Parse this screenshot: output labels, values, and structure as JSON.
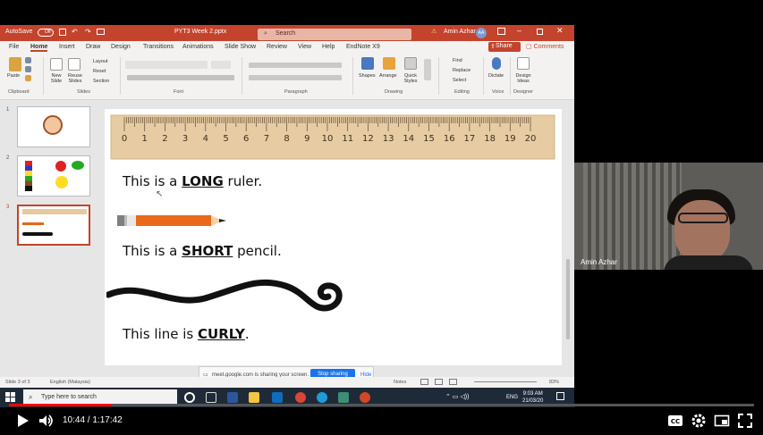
{
  "ppt": {
    "autosave": "AutoSave",
    "autosave_state": "Off",
    "file_title": "PYT3 Week 2.pptx",
    "search_placeholder": "Search",
    "user": "Amin Azhar",
    "user_initials": "AA",
    "menu_tabs": [
      "File",
      "Home",
      "Insert",
      "Draw",
      "Design",
      "Transitions",
      "Animations",
      "Slide Show",
      "Review",
      "View",
      "Help",
      "EndNote X9"
    ],
    "active_tab": "Home",
    "share_label": "Share",
    "comments_label": "Comments",
    "ribbon": {
      "paste": "Paste",
      "new_slide": "New Slide",
      "reuse_slides": "Reuse Slides",
      "layout": "Layout",
      "reset": "Reset",
      "section": "Section",
      "shapes": "Shapes",
      "arrange": "Arrange",
      "quick_styles": "Quick Styles",
      "find": "Find",
      "replace": "Replace",
      "select": "Select",
      "dictate": "Dictate",
      "design_ideas": "Design Ideas",
      "groups": [
        "Clipboard",
        "Slides",
        "Font",
        "Paragraph",
        "Drawing",
        "Editing",
        "Voice",
        "Designer"
      ]
    },
    "thumb_numbers": [
      "1",
      "2",
      "3"
    ],
    "slide": {
      "ruler_numbers": [
        "0",
        "1",
        "2",
        "3",
        "4",
        "5",
        "6",
        "7",
        "8",
        "9",
        "10",
        "11",
        "12",
        "13",
        "14",
        "15",
        "16",
        "17",
        "18",
        "19",
        "20"
      ],
      "line1_pre": "This is a ",
      "line1_word": "LONG",
      "line1_post": " ruler.",
      "line2_pre": "This is a ",
      "line2_word": "SHORT",
      "line2_post": " pencil.",
      "line3_pre": "This line is ",
      "line3_word": "CURLY",
      "line3_post": "."
    },
    "share_notice": "meet.google.com is sharing your screen.",
    "stop_sharing": "Stop sharing",
    "hide": "Hide",
    "status": {
      "slide_of": "Slide 3 of 3",
      "language": "English (Malaysia)",
      "notes": "Notes",
      "zoom": "83%"
    },
    "taskbar": {
      "search_placeholder": "Type here to search",
      "lang": "ENG",
      "time": "9:03 AM",
      "date": "21/03/20"
    }
  },
  "webcam": {
    "name": "Amin Azhar"
  },
  "player": {
    "current_time": "10:44",
    "duration": "1:17:42",
    "progress": 0.138
  }
}
